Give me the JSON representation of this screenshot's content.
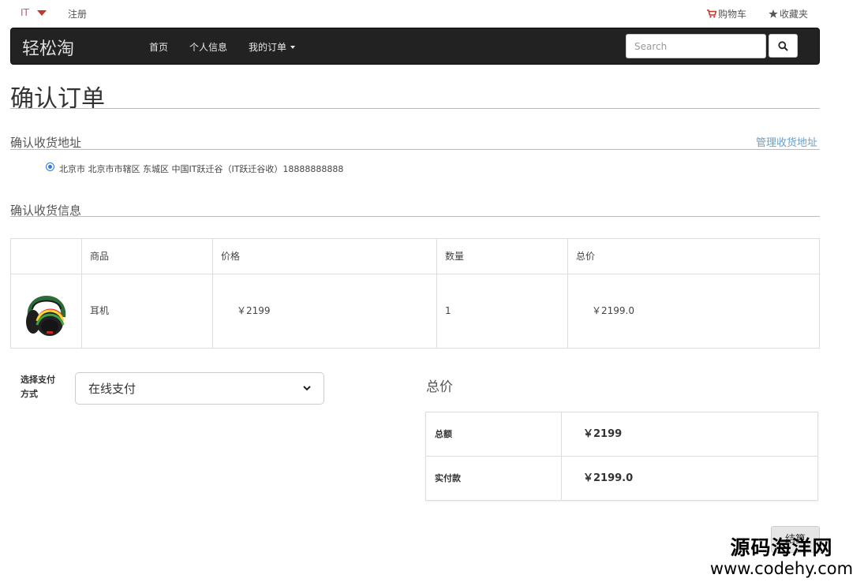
{
  "topbar": {
    "user": "IT",
    "register": "注册",
    "cart": "购物车",
    "favorites": "收藏夹"
  },
  "navbar": {
    "brand": "轻松淘",
    "home": "首页",
    "profile": "个人信息",
    "orders": "我的订单",
    "search_placeholder": "Search"
  },
  "page": {
    "title": "确认订单"
  },
  "address": {
    "section_title": "确认收货地址",
    "manage_link": "管理收货地址",
    "selected_address": "北京市 北京市市辖区 东城区 中国IT跃迁谷（IT跃迁谷收）18888888888"
  },
  "goods": {
    "section_title": "确认收货信息",
    "headers": [
      "",
      "商品",
      "价格",
      "数量",
      "总价"
    ],
    "rows": [
      {
        "name": "耳机",
        "price": "￥2199",
        "quantity": "1",
        "total": "￥2199.0"
      }
    ]
  },
  "payment": {
    "label": "选择支付方式",
    "selected": "在线支付"
  },
  "summary": {
    "title": "总价",
    "amount_label": "总额",
    "amount_value": "￥2199",
    "paid_label": "实付款",
    "paid_value": "￥2199.0"
  },
  "checkout_label": "结算",
  "watermark": {
    "line1": "源码海洋网",
    "line2": "www.codehy.com"
  },
  "colors": {
    "navbar_bg": "#222222",
    "link": "#6a9ec8",
    "accent_red": "#c0392b"
  }
}
